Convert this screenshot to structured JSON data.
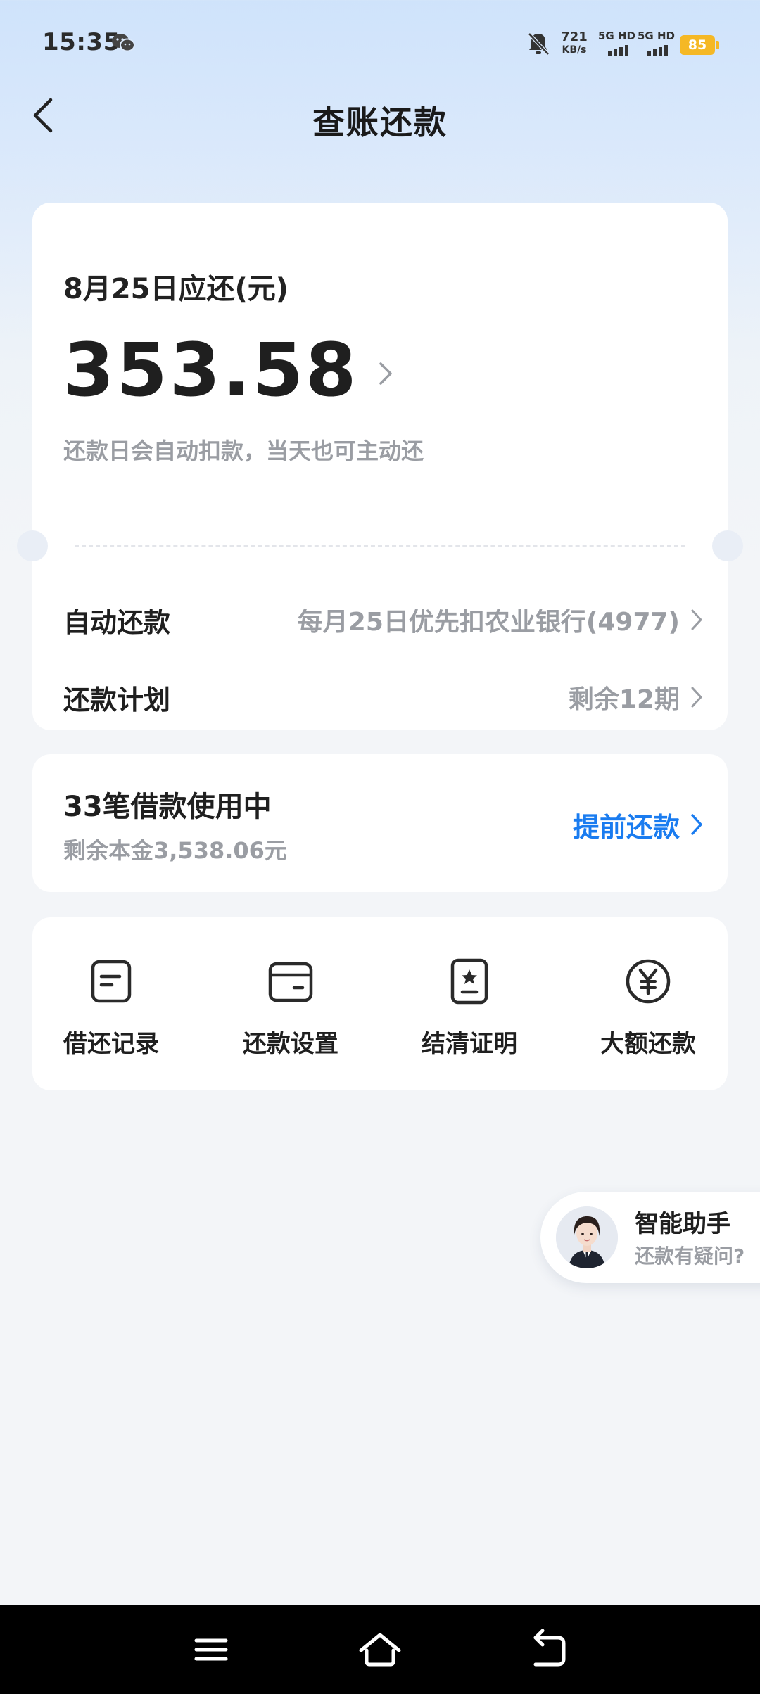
{
  "status_bar": {
    "time": "15:35",
    "net_speed": "721",
    "net_speed_unit": "KB/s",
    "sim1_label": "5G HD",
    "sim2_label": "5G HD",
    "battery": "85",
    "battery_color": "#f5b825"
  },
  "header": {
    "title": "查账还款",
    "back_icon": "chevron-left-icon"
  },
  "due_card": {
    "due_label": "8月25日应还(元)",
    "amount": "353.58",
    "note": "还款日会自动扣款，当天也可主动还",
    "rows": [
      {
        "label": "自动还款",
        "value": "每月25日优先扣农业银行(4977)"
      },
      {
        "label": "还款计划",
        "value": "剩余12期"
      }
    ]
  },
  "loans_card": {
    "title": "33笔借款使用中",
    "principal": "剩余本金3,538.06元",
    "prepay_label": "提前还款",
    "accent_color": "#1a7cf0"
  },
  "tools": [
    {
      "label": "借还记录",
      "icon": "record-icon"
    },
    {
      "label": "还款设置",
      "icon": "wallet-icon"
    },
    {
      "label": "结清证明",
      "icon": "certificate-icon"
    },
    {
      "label": "大额还款",
      "icon": "yuan-icon"
    }
  ],
  "assistant": {
    "title": "智能助手",
    "subtitle": "还款有疑问?"
  },
  "nav": {
    "menu_icon": "menu-icon",
    "home_icon": "home-icon",
    "back_icon": "back-icon"
  }
}
